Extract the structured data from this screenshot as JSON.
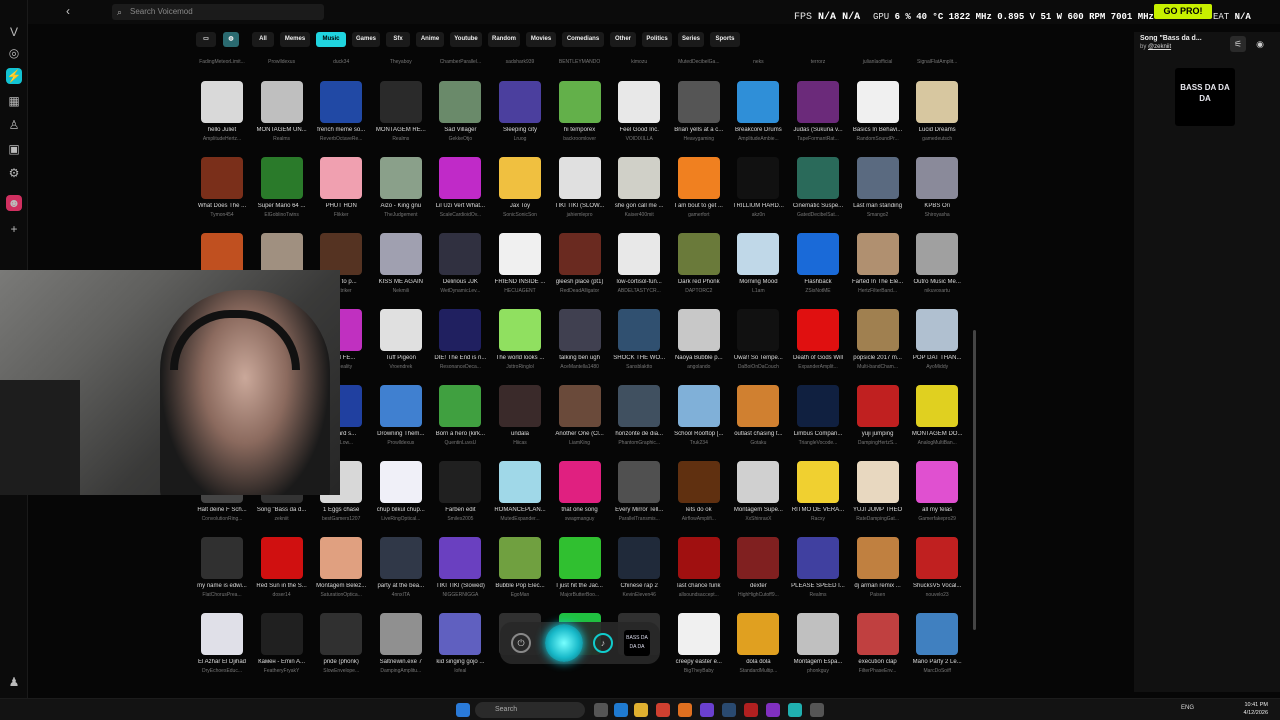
{
  "app": {
    "search_placeholder": "Search Voicemod",
    "go_pro": "GO PRO!"
  },
  "hud": {
    "fps_label": "FPS",
    "fps_value": "N/A",
    "fps_value2": "N/A",
    "gpu_label": "GPU",
    "gpu_usage": "6 %",
    "gpu_temp": "40 °C",
    "gpu_clock": "1822 MHz",
    "gpu_volt": "0.895 V",
    "gpu_power": "51 W",
    "gpu_fan": "600 RPM",
    "gpu_mem": "7001 MHz",
    "cpu_label": "CPU",
    "eat_label": "EAT",
    "eat_value": "N/A",
    "eat_value2": "N/A"
  },
  "categories": [
    "All",
    "Memes",
    "Music",
    "Games",
    "Sfx",
    "Anime",
    "Youtube",
    "Random",
    "Movies",
    "Comedians",
    "Other",
    "Politics",
    "Series",
    "Sports"
  ],
  "selected_category": "Music",
  "top_row": [
    "FadingMeteorLimit...",
    "Prowlldexus",
    "duck34",
    "Theyaboy",
    "ChamberParallel...",
    "sadshark939",
    "BENTLEYMANDO",
    "kimozu",
    "MutedDecibelGa...",
    "neks",
    "terrorz",
    "julianlaofficial",
    "SignalFlatAmplit..."
  ],
  "sounds": [
    [
      {
        "title": "hello Juliet",
        "author": "AmplitudeHertz...",
        "color": "#d9d9d9"
      },
      {
        "title": "MONTAGEM UN...",
        "author": "Realms",
        "color": "#bfbfbf"
      },
      {
        "title": "french meme so...",
        "author": "ReverbOctaveRe...",
        "color": "#2149a5"
      },
      {
        "title": "MONTAGEM RE...",
        "author": "Realms",
        "color": "#2a2a2a"
      },
      {
        "title": "Sad Villager",
        "author": "GekkeOtjo",
        "color": "#6a8a6a"
      },
      {
        "title": "Sleeping city",
        "author": "Lruog",
        "color": "#4b3f9e"
      },
      {
        "title": "hi temporex",
        "author": "backroomlover",
        "color": "#63b04a"
      },
      {
        "title": "Feel Good Inc.",
        "author": "VOIDIXILLA",
        "color": "#e8e8e8"
      },
      {
        "title": "Brian yells at a c...",
        "author": "Heavygaming",
        "color": "#555555"
      },
      {
        "title": "Breakcore Drums",
        "author": "AmplitudeAmbie...",
        "color": "#2f8fd8"
      },
      {
        "title": "Judas (Sukuna v...",
        "author": "TapeFormantRat...",
        "color": "#6b2a7a"
      },
      {
        "title": "Basics In Behavi...",
        "author": "RandomSoundPr...",
        "color": "#f0f0f0"
      },
      {
        "title": "Lucid Dreams",
        "author": "gamedeutsch",
        "color": "#d7c7a0"
      }
    ],
    [
      {
        "title": "What Does The ...",
        "author": "Tymon454",
        "color": "#7a2f1a"
      },
      {
        "title": "Super Mario 64 ...",
        "author": "ElGoblinoTwins",
        "color": "#2a7a2a"
      },
      {
        "title": "PHUT HON",
        "author": "Flikker",
        "color": "#f0a0b0"
      },
      {
        "title": "Aizo - King gnu",
        "author": "TheJudgement",
        "color": "#8aa08a"
      },
      {
        "title": "Lil Uzi Vert What...",
        "author": "ScaleCardioidOv...",
        "color": "#c02ac8"
      },
      {
        "title": "Jax Toy",
        "author": "SonicSonicSon",
        "color": "#f0c040"
      },
      {
        "title": "TIKI TIKI (SLOW...",
        "author": "jahiemlepro",
        "color": "#e0e0e0"
      },
      {
        "title": "she gon call me ...",
        "author": "Kaiser400mit",
        "color": "#d0d0c8"
      },
      {
        "title": "I am bout to get ...",
        "author": "gamerfort",
        "color": "#f08020"
      },
      {
        "title": "TRILLIUM HARD...",
        "author": "akz0n",
        "color": "#111111"
      },
      {
        "title": "Cinematic Suspe...",
        "author": "GatedDecibelSat...",
        "color": "#2a6a5a"
      },
      {
        "title": "Last man standing",
        "author": "Smango2",
        "color": "#5a6a80"
      },
      {
        "title": "KPBS Ori",
        "author": "Shiroyasha",
        "color": "#8a8a9a"
      }
    ],
    [
      {
        "title": "...",
        "author": "...",
        "color": "#c05020"
      },
      {
        "title": "...",
        "author": "...",
        "color": "#a09080"
      },
      {
        "title": "...kes to p...",
        "author": "...kZtriker",
        "color": "#553322"
      },
      {
        "title": "KISS ME AGAIN",
        "author": "Nekmili",
        "color": "#a0a0b0"
      },
      {
        "title": "Delirious JJK",
        "author": "WetDynamicLev...",
        "color": "#303040"
      },
      {
        "title": "FRIEND INSIDE ...",
        "author": "HECUAGENT",
        "color": "#f0f0f0"
      },
      {
        "title": "gleesh place (pt1)",
        "author": "RedDeadAlligator",
        "color": "#6a2a20"
      },
      {
        "title": "low-cortisol-fun...",
        "author": "ABDELTASTYCR...",
        "color": "#e8e8e8"
      },
      {
        "title": "Dark red Phonk",
        "author": "DAPTORC2",
        "color": "#6a7a3a"
      },
      {
        "title": "Morning Mood",
        "author": "L1am",
        "color": "#c0d8e8"
      },
      {
        "title": "Flashback",
        "author": "ZSisNotME",
        "color": "#1a6ad8"
      },
      {
        "title": "Farted In The Ele...",
        "author": "HertzFilterBand...",
        "color": "#b09070"
      },
      {
        "title": "Outro Music Me...",
        "author": "nikuvoxartu",
        "color": "#a0a0a0"
      }
    ],
    [
      {
        "title": "...",
        "author": "...",
        "color": "#777777"
      },
      {
        "title": "...",
        "author": "...",
        "color": "#666666"
      },
      {
        "title": "...EM FE...",
        "author": "...yReality",
        "color": "#c030c0"
      },
      {
        "title": "Tuff Pigeon",
        "author": "Vroendrek",
        "color": "#e0e0e0"
      },
      {
        "title": "DIE! The End is n...",
        "author": "ResonanceDeca...",
        "color": "#202060"
      },
      {
        "title": "The world looks ...",
        "author": "JsttroRinglol",
        "color": "#90e060"
      },
      {
        "title": "talking ben ugh",
        "author": "AceMantella1480",
        "color": "#404050"
      },
      {
        "title": "SHOCK THE WO...",
        "author": "Sansblaktto",
        "color": "#305070"
      },
      {
        "title": "Naoya Bubble p...",
        "author": "angolando",
        "color": "#c8c8c8"
      },
      {
        "title": "Uwa!! So Tempe...",
        "author": "DaBoiOnDaCouch",
        "color": "#111111"
      },
      {
        "title": "Death of Gods Will",
        "author": "ExpanderAmplit...",
        "color": "#e01010"
      },
      {
        "title": "popsicle 2017 m...",
        "author": "Multi-bandCham...",
        "color": "#a08050"
      },
      {
        "title": "POP DAT THAN...",
        "author": "AyoMiddy",
        "color": "#b0c0d0"
      }
    ],
    [
      {
        "title": "...",
        "author": "...",
        "color": "#555555"
      },
      {
        "title": "...",
        "author": "...",
        "color": "#555555"
      },
      {
        "title": "...board s...",
        "author": "...owLow...",
        "color": "#2040a0"
      },
      {
        "title": "Drowning Them...",
        "author": "Prowlldexus",
        "color": "#4080d0"
      },
      {
        "title": "Born a hero (kirk...",
        "author": "QuentinLuvsU",
        "color": "#40a040"
      },
      {
        "title": "undala",
        "author": "Hiicas",
        "color": "#3a2a2a"
      },
      {
        "title": "Another One (Cl...",
        "author": "LiamKing",
        "color": "#6a4a3a"
      },
      {
        "title": "horizonte de dia...",
        "author": "PhantomGraphic...",
        "color": "#405060"
      },
      {
        "title": "School Rooftop [...",
        "author": "Truk234",
        "color": "#80b0d8"
      },
      {
        "title": "outlast chasing t...",
        "author": "Gotaku",
        "color": "#d08030"
      },
      {
        "title": "Limbus Compan...",
        "author": "TriangleVocode...",
        "color": "#102040"
      },
      {
        "title": "yuji jumping",
        "author": "DampingHertzS...",
        "color": "#c02020"
      },
      {
        "title": "MONTAGEM DO...",
        "author": "AnalogMultiBan...",
        "color": "#e0d020"
      }
    ],
    [
      {
        "title": "Halt deine F Sch...",
        "author": "ConvolutionRing...",
        "color": "#444444"
      },
      {
        "title": "Song \"Bass da d...",
        "author": "zekniit",
        "color": "#333333"
      },
      {
        "title": "1 Eggs chase",
        "author": "bestGamers1207",
        "color": "#d8d8d8"
      },
      {
        "title": "chup bilkul chup...",
        "author": "LiveRingOptical...",
        "color": "#f0f0f8"
      },
      {
        "title": "Farben edit",
        "author": "Smiles2005",
        "color": "#202020"
      },
      {
        "title": "ROMANCEPLAN...",
        "author": "MutedExpander...",
        "color": "#a0d8e8"
      },
      {
        "title": "that one song",
        "author": "swagmanguy",
        "color": "#e02080"
      },
      {
        "title": "Every Mirror Tell...",
        "author": "ParallelTransmis...",
        "color": "#505050"
      },
      {
        "title": "lets do ok",
        "author": "AirflowAmplifi...",
        "color": "#603010"
      },
      {
        "title": "Montagem Supe...",
        "author": "XxShinraxX",
        "color": "#d0d0d0"
      },
      {
        "title": "RITMO DE VERA...",
        "author": "Racxy",
        "color": "#f0d030"
      },
      {
        "title": "YUJI JUMP THEO",
        "author": "RateDampingGat...",
        "color": "#e8d8c0"
      },
      {
        "title": "all my felas",
        "author": "Gamerfakepro29",
        "color": "#e050d0"
      }
    ],
    [
      {
        "title": "my name is edwi...",
        "author": "FlatChorusPrea...",
        "color": "#303030"
      },
      {
        "title": "Red Sun in the S...",
        "author": "doser14",
        "color": "#d01010"
      },
      {
        "title": "Montagem Belez...",
        "author": "SaturationOptica...",
        "color": "#e0a080"
      },
      {
        "title": "party at the bea...",
        "author": "4nnxITA",
        "color": "#303848"
      },
      {
        "title": "TIKI TIKI (Slowed)",
        "author": "NIGGERNIGGA",
        "color": "#6a40c0"
      },
      {
        "title": "Bubble Pop Elec...",
        "author": "EgoMan",
        "color": "#70a040"
      },
      {
        "title": "I just hit the Jac...",
        "author": "MajorButterBoo...",
        "color": "#30c030"
      },
      {
        "title": "Chinese rap 2",
        "author": "KevinEleven46",
        "color": "#202a3a"
      },
      {
        "title": "last chance funk",
        "author": "allsoundsaccept...",
        "color": "#a01010"
      },
      {
        "title": "dexter",
        "author": "HighHighCutoff9...",
        "color": "#802020"
      },
      {
        "title": "PLEASE SPEED I...",
        "author": "Realms",
        "color": "#4040a0"
      },
      {
        "title": "dj arman remix ...",
        "author": "Paisen",
        "color": "#c08040"
      },
      {
        "title": "ShucksV5 Vocal...",
        "author": "nouvelo23",
        "color": "#c02020"
      }
    ],
    [
      {
        "title": "El Azhar El Djihad",
        "author": "DryEchoesEduc...",
        "color": "#e0e0e8"
      },
      {
        "title": "Камен - Emin A...",
        "author": "FeatheryFryakY",
        "color": "#202020"
      },
      {
        "title": "pride (phonk)",
        "author": "SlowEnvelope...",
        "color": "#303030"
      },
      {
        "title": "Saltnewin.exe 7",
        "author": "DampingAmplitu...",
        "color": "#909090"
      },
      {
        "title": "kid singing gojo ...",
        "author": "lofeal",
        "color": "#6060c0"
      },
      {
        "title": "",
        "author": "",
        "color": "#303030"
      },
      {
        "title": "",
        "author": "",
        "color": "#20c040"
      },
      {
        "title": "",
        "author": "",
        "color": "#303030"
      },
      {
        "title": "creepy easter e...",
        "author": "BigTheyBaby",
        "color": "#f0f0f0"
      },
      {
        "title": "dola dola",
        "author": "StandardMultip...",
        "color": "#e0a020"
      },
      {
        "title": "Montagem Espa...",
        "author": "phonkguy",
        "color": "#c0c0c0"
      },
      {
        "title": "execution clap",
        "author": "FilterPhaseEnv...",
        "color": "#c04040"
      },
      {
        "title": "Mario Party 2 Le...",
        "author": "MarcDoSoiff",
        "color": "#4080c0"
      }
    ]
  ],
  "panel": {
    "title": "Song \"Bass da d...",
    "by_prefix": "by",
    "by_user": "@zekniit",
    "art_text": "BASS DA DA DA"
  },
  "dock": {
    "thumb_text": "BASS DA DA DA"
  },
  "taskbar": {
    "search": "Search",
    "lang": "ENG",
    "time": "10:41 PM",
    "date": "4/12/2026"
  },
  "colors": {
    "accent": "#20d4df",
    "gopro": "#c7f000"
  }
}
